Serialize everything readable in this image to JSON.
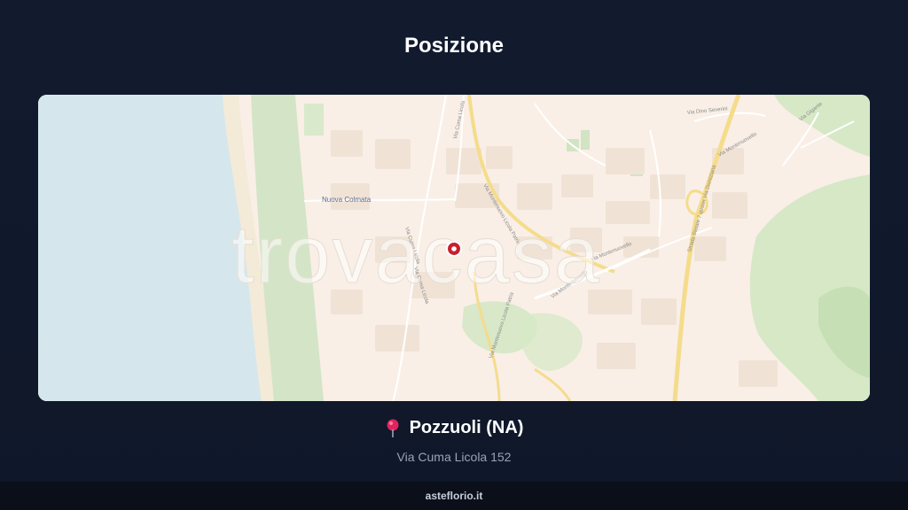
{
  "page": {
    "title": "Posizione"
  },
  "map": {
    "watermark": "trovacasa",
    "labels": {
      "nuova_colmata": "Nuova Colmata",
      "via_cuma_licola_top": "Via Cuma Licola",
      "via_montenuovo_licola_patria": "Via Montenuovo Licola Patria",
      "via_montenuovo_licola_patria_2": "Via Montenuovo Licola Patria",
      "via_cuma_licola_mid": "Via Cuma Licola",
      "via_cuma_licola_lower": "Via Cuma Licola",
      "via_montenuovello": "Via Montenuovello",
      "via_montenuovello_2": "Via Montenuovello",
      "via_dino_severini": "Via Dino Severini",
      "strada_statale": "Strada Statale 7 quater Via Domiziana",
      "via_montenuovello_right": "Via Montenuovello",
      "via_gigante": "Via Gigante"
    },
    "colors": {
      "sea": "#d5e7ec",
      "land": "#f9efe7",
      "green": "#cde3bf",
      "road_major": "#f5dc8c",
      "marker": "#c8202e"
    }
  },
  "location": {
    "city": "Pozzuoli (NA)",
    "address": "Via Cuma Licola 152",
    "pin_icon": "round-pushpin-icon"
  },
  "footer": {
    "brand": "asteflorio.it"
  }
}
